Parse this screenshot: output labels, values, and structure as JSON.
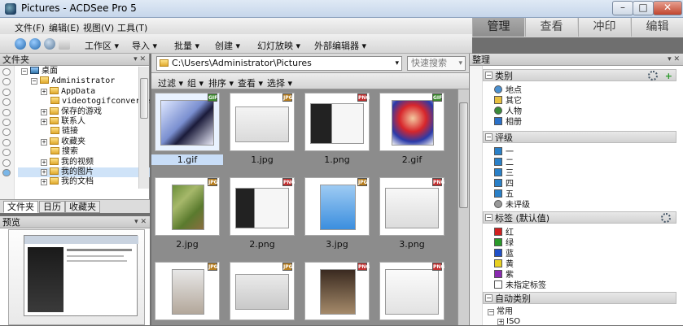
{
  "window": {
    "title": "Pictures - ACDSee Pro 5",
    "min": "–",
    "max": "□",
    "close": "✕"
  },
  "menu": [
    "文件(F)",
    "编辑(E)",
    "视图(V)",
    "工具(T)"
  ],
  "modes": [
    "管理",
    "查看",
    "冲印",
    "编辑"
  ],
  "toolbar": [
    "工作区 ▾",
    "导入 ▾",
    "批量 ▾",
    "创建 ▾",
    "幻灯放映 ▾",
    "外部编辑器 ▾"
  ],
  "folders_panel": {
    "title": "文件夹",
    "tree": [
      "桌面",
      "Administrator",
      "AppData",
      "videotogifconverte",
      "保存的游戏",
      "联系人",
      "链接",
      "收藏夹",
      "搜索",
      "我的视频",
      "我的图片",
      "我的文档"
    ],
    "tabs": [
      "文件夹",
      "日历",
      "收藏夹"
    ]
  },
  "preview_panel": {
    "title": "预览"
  },
  "address": {
    "path": "C:\\Users\\Administrator\\Pictures",
    "search_placeholder": "快速搜索"
  },
  "filters": [
    "过滤 ▾",
    "组 ▾",
    "排序 ▾",
    "查看 ▾",
    "选择 ▾"
  ],
  "files": [
    {
      "name": "1.gif",
      "type": "GIF"
    },
    {
      "name": "1.jpg",
      "type": "JPG"
    },
    {
      "name": "1.png",
      "type": "PNG"
    },
    {
      "name": "2.gif",
      "type": "GIF"
    },
    {
      "name": "2.jpg",
      "type": "JPG"
    },
    {
      "name": "2.png",
      "type": "PNG"
    },
    {
      "name": "3.jpg",
      "type": "JPG"
    },
    {
      "name": "3.png",
      "type": "PNG"
    },
    {
      "name": "",
      "type": "JPG"
    },
    {
      "name": "",
      "type": "JPG"
    },
    {
      "name": "",
      "type": "PNG"
    },
    {
      "name": "",
      "type": "PNG"
    }
  ],
  "organize": {
    "title": "整理",
    "categories": {
      "title": "类别",
      "items": [
        "地点",
        "其它",
        "人物",
        "相册"
      ]
    },
    "ratings": {
      "title": "评级",
      "items": [
        "一",
        "二",
        "三",
        "四",
        "五",
        "未评级"
      ]
    },
    "labels": {
      "title": "标签 (默认值)",
      "items": [
        {
          "name": "红",
          "color": "#d02020"
        },
        {
          "name": "绿",
          "color": "#2a9a2a"
        },
        {
          "name": "蓝",
          "color": "#2050c8"
        },
        {
          "name": "黄",
          "color": "#e8d020"
        },
        {
          "name": "紫",
          "color": "#8a2ab0"
        },
        {
          "name": "未指定标签",
          "color": "#ffffff"
        }
      ]
    },
    "auto_categories": {
      "title": "自动类别",
      "items": [
        "常用",
        "ISO"
      ]
    }
  }
}
